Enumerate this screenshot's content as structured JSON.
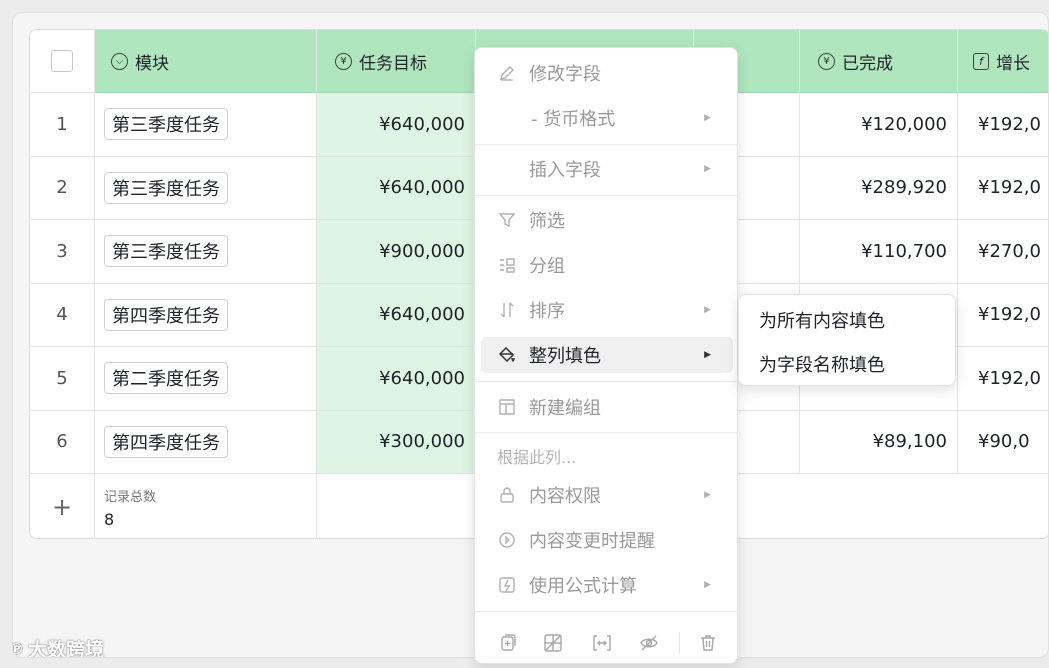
{
  "table": {
    "columns": [
      {
        "label": "模块",
        "icon": "circle-chevron-icon"
      },
      {
        "label": "任务目标",
        "icon": "currency-icon"
      },
      {
        "label": "",
        "icon": ""
      },
      {
        "label": "",
        "icon": ""
      },
      {
        "label": "已完成",
        "icon": "currency-icon"
      },
      {
        "label": "增长",
        "icon": "formula-icon"
      }
    ],
    "rows": [
      {
        "num": "1",
        "module": "第三季度任务",
        "target": "¥640,000",
        "done": "¥120,000",
        "growth": "¥192,0"
      },
      {
        "num": "2",
        "module": "第三季度任务",
        "target": "¥640,000",
        "done": "¥289,920",
        "growth": "¥192,0"
      },
      {
        "num": "3",
        "module": "第三季度任务",
        "target": "¥900,000",
        "done": "¥110,700",
        "growth": "¥270,0"
      },
      {
        "num": "4",
        "module": "第四季度任务",
        "target": "¥640,000",
        "done": "",
        "growth": "¥192,0"
      },
      {
        "num": "5",
        "module": "第二季度任务",
        "target": "¥640,000",
        "done": "",
        "growth": "¥192,0"
      },
      {
        "num": "6",
        "module": "第四季度任务",
        "target": "¥300,000",
        "done": "¥89,100",
        "growth": "¥90,0"
      }
    ],
    "footer": {
      "add": "+",
      "count_label": "记录总数",
      "count_value": "8"
    }
  },
  "menu": {
    "edit_field": "修改字段",
    "currency_format": "-  货币格式",
    "insert_field": "插入字段",
    "filter": "筛选",
    "group": "分组",
    "sort": "排序",
    "fill_column": "整列填色",
    "new_group": "新建编组",
    "section_label": "根据此列...",
    "permissions": "内容权限",
    "change_alert": "内容变更时提醒",
    "formula": "使用公式计算"
  },
  "submenu": {
    "fill_all": "为所有内容填色",
    "fill_name": "为字段名称填色"
  },
  "watermark": {
    "logo": "℗",
    "text": "大数跨境"
  },
  "colors": {
    "header": "#b0e6bd",
    "highlight": "#dff5e4"
  }
}
